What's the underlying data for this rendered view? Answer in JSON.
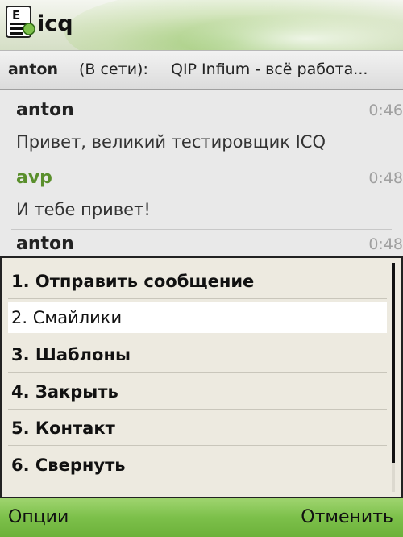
{
  "app": {
    "title": "icq",
    "icon": "icq-app-icon"
  },
  "contact": {
    "name": "anton",
    "status": "(В сети):",
    "status_message": "QIP Infium - всё работа..."
  },
  "messages": [
    {
      "author": "anton",
      "time": "0:46",
      "text": "Привет, великий тестировщик ICQ",
      "is_me": false
    },
    {
      "author": "avp",
      "time": "0:48",
      "text": "И тебе привет!",
      "is_me": true
    },
    {
      "author": "anton",
      "time": "0:48",
      "text": "",
      "is_me": false
    }
  ],
  "menu": {
    "items": [
      {
        "label": "1. Отправить сообщение"
      },
      {
        "label": "2. Смайлики",
        "selected": true
      },
      {
        "label": "3. Шаблоны"
      },
      {
        "label": "4. Закрыть"
      },
      {
        "label": "5. Контакт"
      },
      {
        "label": "6. Свернуть"
      }
    ]
  },
  "softkeys": {
    "left": "Опции",
    "right": "Отменить"
  },
  "colors": {
    "softkey_bar": "#7cc04a",
    "author_me": "#5a8f2c",
    "menu_bg": "#edeae0",
    "selected_bg": "#ffffff"
  }
}
